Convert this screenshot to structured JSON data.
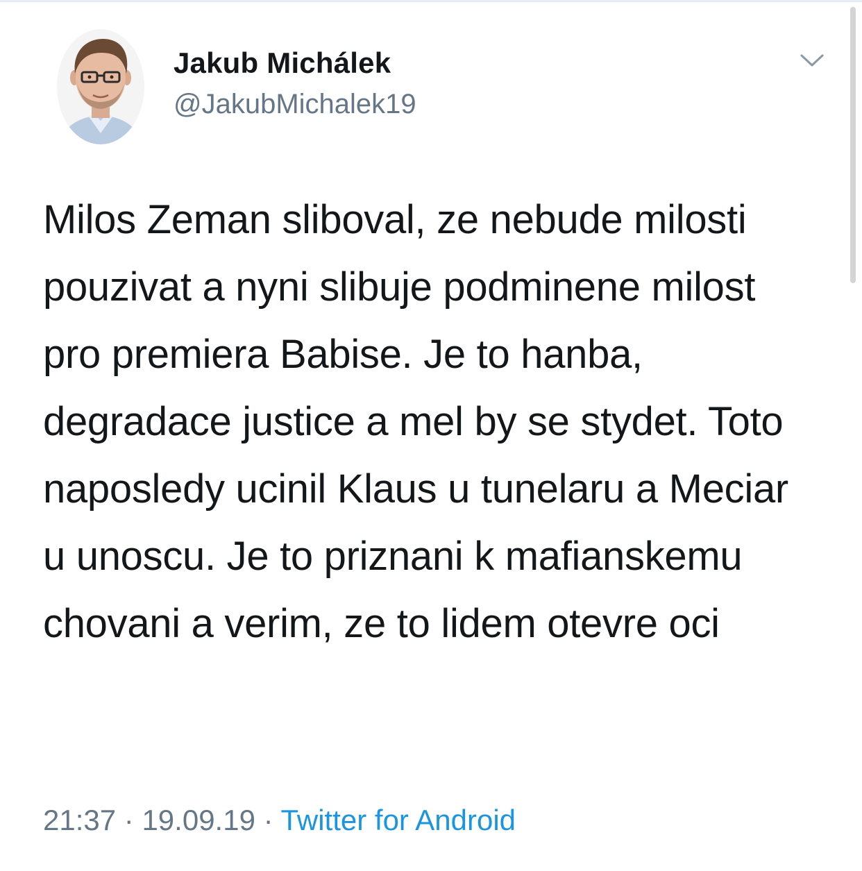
{
  "tweet": {
    "author": {
      "name": "Jakub Michálek",
      "handle": "@JakubMichalek19",
      "avatar_icon": "profile-photo"
    },
    "text": "Milos Zeman sliboval, ze nebude milosti pouzivat a nyni slibuje podminene milost pro premiera Babise. Je to hanba, degradace justice a mel by se stydet. Toto naposledy ucinil Klaus u tunelaru a Meciar u unoscu. Je to priznani k mafianskemu chovani a verim, ze to lidem otevre oci",
    "time": "21:37",
    "separator": "·",
    "date": "19.09.19",
    "source": "Twitter for Android",
    "menu_icon": "chevron-down-icon"
  },
  "colors": {
    "text_primary": "#14171a",
    "text_secondary": "#657786",
    "link": "#1b95e0",
    "divider": "#e6ecf0"
  }
}
